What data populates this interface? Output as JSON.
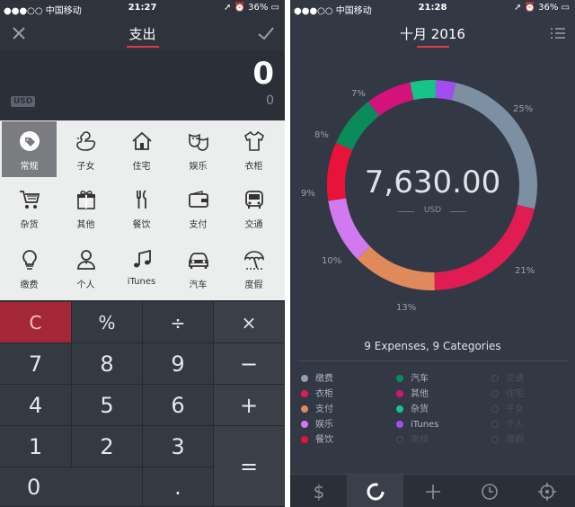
{
  "left": {
    "status": {
      "carrier": "●●●○○ 中国移动",
      "time": "21:27",
      "battery": "36%"
    },
    "title": "支出",
    "amount": "0",
    "amount_secondary": "0",
    "currency": "USD",
    "categories": [
      {
        "label": "常规",
        "icon": "tag-icon",
        "selected": true
      },
      {
        "label": "子女",
        "icon": "duck-icon"
      },
      {
        "label": "住宅",
        "icon": "house-icon"
      },
      {
        "label": "娱乐",
        "icon": "theater-masks-icon"
      },
      {
        "label": "衣柜",
        "icon": "tshirt-icon"
      },
      {
        "label": "杂货",
        "icon": "shopping-cart-icon"
      },
      {
        "label": "其他",
        "icon": "gift-icon"
      },
      {
        "label": "餐饮",
        "icon": "fork-knife-icon"
      },
      {
        "label": "支付",
        "icon": "wallet-icon"
      },
      {
        "label": "交通",
        "icon": "bus-icon"
      },
      {
        "label": "缴费",
        "icon": "lightbulb-icon"
      },
      {
        "label": "个人",
        "icon": "person-icon"
      },
      {
        "label": "iTunes",
        "icon": "music-note-icon"
      },
      {
        "label": "汽车",
        "icon": "car-icon"
      },
      {
        "label": "度假",
        "icon": "beach-umbrella-icon"
      }
    ],
    "keys": {
      "clear": "C",
      "percent": "%",
      "divide": "÷",
      "multiply": "×",
      "k7": "7",
      "k8": "8",
      "k9": "9",
      "minus": "−",
      "k4": "4",
      "k5": "5",
      "k6": "6",
      "plus": "+",
      "k1": "1",
      "k2": "2",
      "k3": "3",
      "equals": "=",
      "k0": "0",
      "dot": "."
    }
  },
  "right": {
    "status": {
      "carrier": "●●●○○ 中国移动",
      "time": "21:28",
      "battery": "36%"
    },
    "title": "十月 2016",
    "total": "7,630.00",
    "currency": "USD",
    "summary": "9 Expenses, 9 Categories",
    "segment_labels": {
      "gray": "25%",
      "crimson": "21%",
      "orange": "13%",
      "violet": "10%",
      "red": "9%",
      "green": "8%",
      "magenta": "7%"
    },
    "legend": [
      {
        "label": "缴费",
        "color": "#8fa0b3",
        "active": true
      },
      {
        "label": "汽车",
        "color": "#0c8b5a",
        "active": true
      },
      {
        "label": "交通",
        "color": "",
        "active": false
      },
      {
        "label": "衣柜",
        "color": "#e01c52",
        "active": true
      },
      {
        "label": "其他",
        "color": "#d3137a",
        "active": true
      },
      {
        "label": "住宅",
        "color": "",
        "active": false
      },
      {
        "label": "支付",
        "color": "#e08a5c",
        "active": true
      },
      {
        "label": "杂货",
        "color": "#18c38a",
        "active": true
      },
      {
        "label": "子女",
        "color": "",
        "active": false
      },
      {
        "label": "娱乐",
        "color": "#d17af0",
        "active": true
      },
      {
        "label": "iTunes",
        "color": "#a34df0",
        "active": true
      },
      {
        "label": "个人",
        "color": "",
        "active": false
      },
      {
        "label": "餐饮",
        "color": "#e8123a",
        "active": true
      },
      {
        "label": "常规",
        "color": "",
        "active": false
      },
      {
        "label": "度假",
        "color": "",
        "active": false
      }
    ],
    "tabs": [
      {
        "name": "tab-dollar",
        "icon": "dollar-icon"
      },
      {
        "name": "tab-stats",
        "icon": "donut-chart-icon",
        "active": true
      },
      {
        "name": "tab-add",
        "icon": "plus-icon"
      },
      {
        "name": "tab-history",
        "icon": "clock-icon"
      },
      {
        "name": "tab-target",
        "icon": "target-icon"
      }
    ]
  },
  "chart_data": {
    "type": "pie",
    "categories": [
      "缴费",
      "衣柜",
      "支付",
      "娱乐",
      "餐饮",
      "汽车",
      "其他",
      "杂货",
      "iTunes"
    ],
    "values": [
      25,
      21,
      13,
      10,
      9,
      8,
      7,
      4,
      3
    ],
    "colors": [
      "#7c8fa3",
      "#e01c52",
      "#e08a5c",
      "#d17af0",
      "#e8123a",
      "#0c8b5a",
      "#d3137a",
      "#18c38a",
      "#a34df0"
    ],
    "data_labels": [
      "25%",
      "21%",
      "13%",
      "10%",
      "9%",
      "8%",
      "7%",
      "",
      ""
    ],
    "total": "7,630.00",
    "unit": "USD",
    "title": ""
  }
}
